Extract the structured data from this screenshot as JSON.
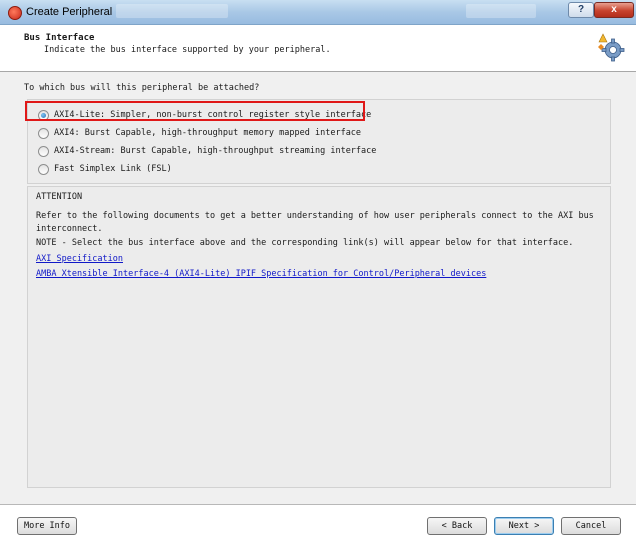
{
  "window": {
    "title": "Create Peripheral",
    "help_label": "?",
    "close_label": "x"
  },
  "header": {
    "title": "Bus Interface",
    "subtitle": "Indicate the bus interface supported by your peripheral."
  },
  "main": {
    "question": "To which bus will this peripheral be attached?",
    "options": [
      {
        "label": "AXI4-Lite: Simpler, non-burst control register style interface",
        "selected": true
      },
      {
        "label": "AXI4: Burst Capable, high-throughput memory mapped interface",
        "selected": false
      },
      {
        "label": "AXI4-Stream: Burst Capable, high-throughput streaming interface",
        "selected": false
      },
      {
        "label": "Fast Simplex Link (FSL)",
        "selected": false
      }
    ],
    "attention": {
      "title": "ATTENTION",
      "body": "Refer to the following documents to get a better understanding of how user peripherals connect to the AXI bus interconnect.",
      "note": "NOTE - Select the bus interface above and the corresponding link(s) will appear below for that interface.",
      "links": [
        "AXI Specification",
        "AMBA Xtensible Interface-4 (AXI4-Lite) IPIF Specification for Control/Peripheral devices"
      ]
    }
  },
  "footer": {
    "more_info": "More Info",
    "back": "< Back",
    "next": "Next >",
    "cancel": "Cancel"
  },
  "colors": {
    "highlight": "#e01818",
    "link": "#1018c8",
    "titlebar": "#a9c8e6"
  }
}
